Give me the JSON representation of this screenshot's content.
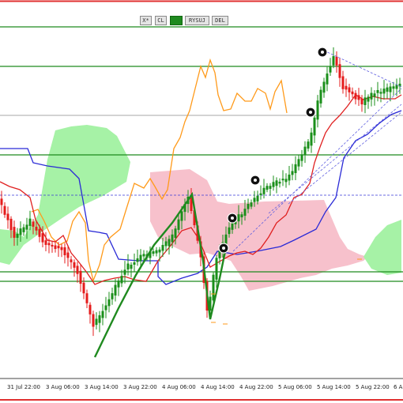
{
  "toolbar": {
    "buttons": [
      {
        "label": "X*",
        "active": false
      },
      {
        "label": "CL",
        "active": false
      },
      {
        "label": "",
        "active": true
      },
      {
        "label": "RYSUJ",
        "active": false
      },
      {
        "label": "DEL",
        "active": false
      }
    ]
  },
  "chart_data": {
    "type": "candlestick",
    "x_tick_labels": [
      "31 Jul 22:00",
      "3 Aug 06:00",
      "3 Aug 14:00",
      "3 Aug 22:00",
      "4 Aug 06:00",
      "4 Aug 14:00",
      "4 Aug 22:00",
      "5 Aug 06:00",
      "5 Aug 14:00",
      "5 Aug 22:00",
      "6 Au"
    ],
    "series": [
      {
        "name": "",
        "kind": "candles",
        "bull_color": "#1a8f1a",
        "bear_color": "#e51c1c"
      },
      {
        "name": "",
        "kind": "fast-line",
        "color": "#e02020"
      },
      {
        "name": "",
        "kind": "slow-line",
        "color": "#2a2ad6"
      },
      {
        "name": "",
        "kind": "lagging-line",
        "color": "#ff9a1a"
      },
      {
        "name": "",
        "kind": "cloud-bull",
        "color": "#a6f2a6"
      },
      {
        "name": "",
        "kind": "cloud-bear",
        "color": "#f7c1cc"
      }
    ],
    "horizontal_levels": 6,
    "grid": false,
    "border_color": "#e03030"
  }
}
